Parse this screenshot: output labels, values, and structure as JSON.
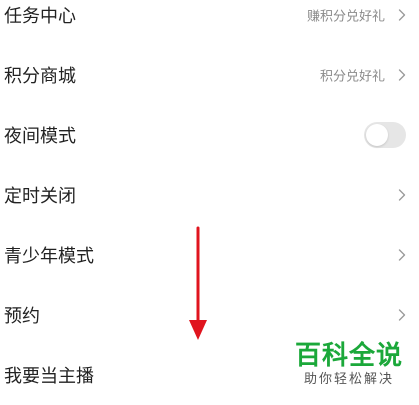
{
  "settings": {
    "items": [
      {
        "label": "任务中心",
        "value": "赚积分兑好礼",
        "control": "chevron"
      },
      {
        "label": "积分商城",
        "value": "积分兑好礼",
        "control": "chevron"
      },
      {
        "label": "夜间模式",
        "value": "",
        "control": "toggle",
        "toggle_on": false
      },
      {
        "label": "定时关闭",
        "value": "",
        "control": "chevron"
      },
      {
        "label": "青少年模式",
        "value": "",
        "control": "chevron"
      },
      {
        "label": "预约",
        "value": "",
        "control": "chevron"
      },
      {
        "label": "我要当主播",
        "value": "",
        "control": "chevron"
      }
    ]
  },
  "annotation": {
    "arrow_color": "#e0141e",
    "direction": "down"
  },
  "watermark": {
    "title": "百科全说",
    "subtitle": "助你轻松解决",
    "title_color": "#1ba83a"
  },
  "icons": {
    "chevron": "chevron-right-icon",
    "arrow": "arrow-down-icon"
  }
}
